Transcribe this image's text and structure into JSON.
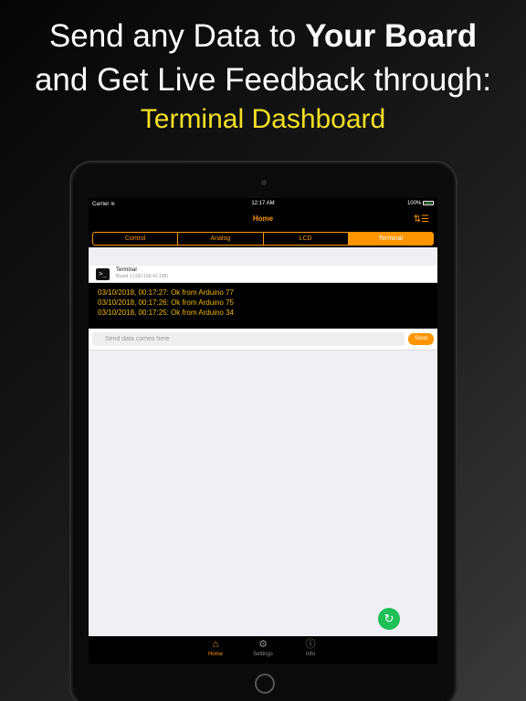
{
  "headline": {
    "line1_prefix": "Send any Data to ",
    "line1_bold": "Your Board",
    "line2": "and Get Live Feedback through:",
    "line3": "Terminal Dashboard"
  },
  "status_bar": {
    "carrier": "Carrier",
    "time": "12:17 AM",
    "battery": "100%"
  },
  "nav": {
    "title": "Home",
    "sort_icon": "sort-icon"
  },
  "tabs_segment": {
    "items": [
      {
        "label": "Control"
      },
      {
        "label": "Analog"
      },
      {
        "label": "LCD"
      },
      {
        "label": "Terminal"
      }
    ],
    "selected": "Terminal"
  },
  "board": {
    "title": "Terminal",
    "subtitle": "Board 1 (192.168.43.198)",
    "icon": "terminal-icon"
  },
  "terminal": {
    "lines": [
      "03/10/2018, 00:17:27: Ok from Arduino 77",
      "03/10/2018, 00:17:26: Ok from Arduino 75",
      "03/10/2018, 00:17:25: Ok from Arduino 34"
    ]
  },
  "send": {
    "placeholder": "Send data comes here",
    "button": "Send"
  },
  "tabbar": {
    "items": [
      {
        "label": "Home",
        "icon": "home-icon",
        "active": true
      },
      {
        "label": "Settings",
        "icon": "gear-icon",
        "active": false
      },
      {
        "label": "Info",
        "icon": "info-icon",
        "active": false
      }
    ]
  },
  "colors": {
    "accent": "#ff9500",
    "terminal_text": "#f2b705",
    "headline_yellow": "#f3e024",
    "refresh": "#1fbf57"
  }
}
